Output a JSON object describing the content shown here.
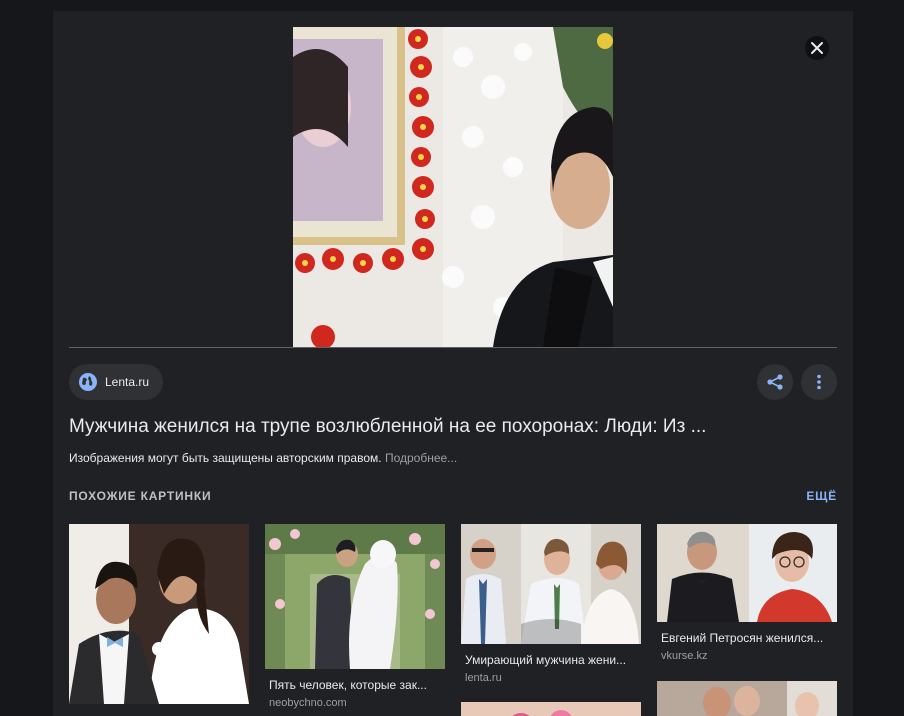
{
  "viewer": {
    "close_label": "✕",
    "source": {
      "name": "Lenta.ru",
      "icon": "globe-icon"
    },
    "actions": {
      "share_icon": "share-icon",
      "more_icon": "more-vert-icon"
    },
    "title": "Мужчина женился на трупе возлюбленной на ее похоронах: Люди: Из ...",
    "copyright_text": "Изображения могут быть защищены авторским правом.",
    "copyright_more": "Подробнее..."
  },
  "related": {
    "heading": "ПОХОЖИЕ КАРТИНКИ",
    "more_label": "ЕЩЁ",
    "items": [
      {
        "title": "",
        "source": ""
      },
      {
        "title": "Пять человек, которые зак...",
        "source": "neobychno.com"
      },
      {
        "title": "Умирающий мужчина жени...",
        "source": "lenta.ru"
      },
      {
        "title": "Евгений Петросян женился...",
        "source": "vkurse.kz"
      }
    ]
  },
  "colors": {
    "page_bg": "#16171a",
    "panel_bg": "#1f2125",
    "chip_bg": "#303134",
    "text": "#e8eaed",
    "muted": "#9aa0a6",
    "accent": "#8ab4f8"
  }
}
